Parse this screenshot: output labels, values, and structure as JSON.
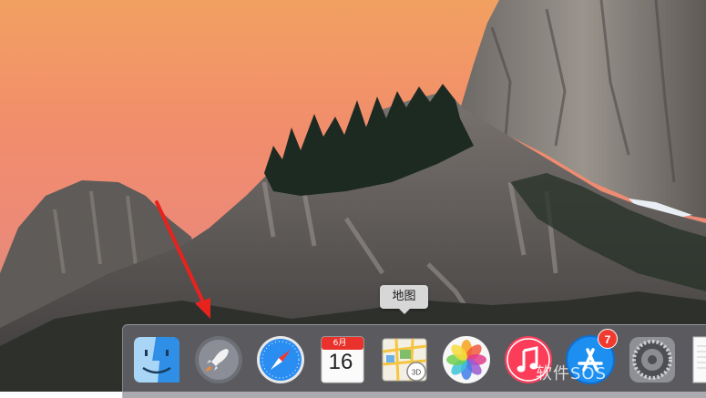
{
  "desktop": {
    "wallpaper": "yosemite",
    "sky_top": "#f2a062",
    "sky_bottom": "#c98a86",
    "arrow_color": "#e8231e"
  },
  "tooltip": {
    "label": "地图"
  },
  "dock": {
    "items": [
      {
        "name": "Finder",
        "icon": "finder-icon"
      },
      {
        "name": "Launchpad",
        "icon": "launchpad-icon"
      },
      {
        "name": "Safari",
        "icon": "safari-icon"
      },
      {
        "name": "Calendar",
        "icon": "calendar-icon",
        "month": "6月",
        "day": "16"
      },
      {
        "name": "Maps",
        "icon": "maps-icon"
      },
      {
        "name": "Photos",
        "icon": "photos-icon"
      },
      {
        "name": "iTunes",
        "icon": "itunes-icon"
      },
      {
        "name": "App Store",
        "icon": "app-store-icon",
        "badge": "7"
      },
      {
        "name": "System Preferences",
        "icon": "gear-icon"
      },
      {
        "name": "TextEdit",
        "icon": "textedit-icon"
      }
    ]
  },
  "watermark": "软件SOS"
}
